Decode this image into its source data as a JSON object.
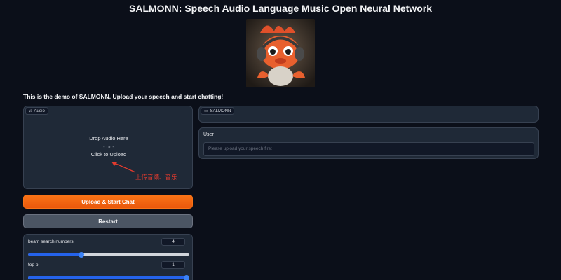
{
  "title": "SALMONN: Speech Audio Language Music Open Neural Network",
  "description": "This is the demo of SALMONN. Upload your speech and start chatting!",
  "audio": {
    "label": "Audio",
    "icon": "music-note-icon",
    "drop_text": "Drop Audio Here",
    "or_text": "- or -",
    "click_text": "Click to Upload"
  },
  "annotation": "上传音频、音乐",
  "buttons": {
    "upload_start": "Upload & Start Chat",
    "restart": "Restart"
  },
  "sliders": [
    {
      "label": "beam search numbers",
      "value": "4",
      "fraction": 0.33
    },
    {
      "label": "top p",
      "value": "1",
      "fraction": 1.0
    }
  ],
  "chatbot": {
    "label": "SALMONN",
    "icon": "chat-icon"
  },
  "user": {
    "label": "User",
    "placeholder": "Please upload your speech first"
  },
  "colors": {
    "accent": "#f97316",
    "slider": "#3b82f6",
    "annotation": "#e33b2e",
    "background": "#0b0f19"
  }
}
